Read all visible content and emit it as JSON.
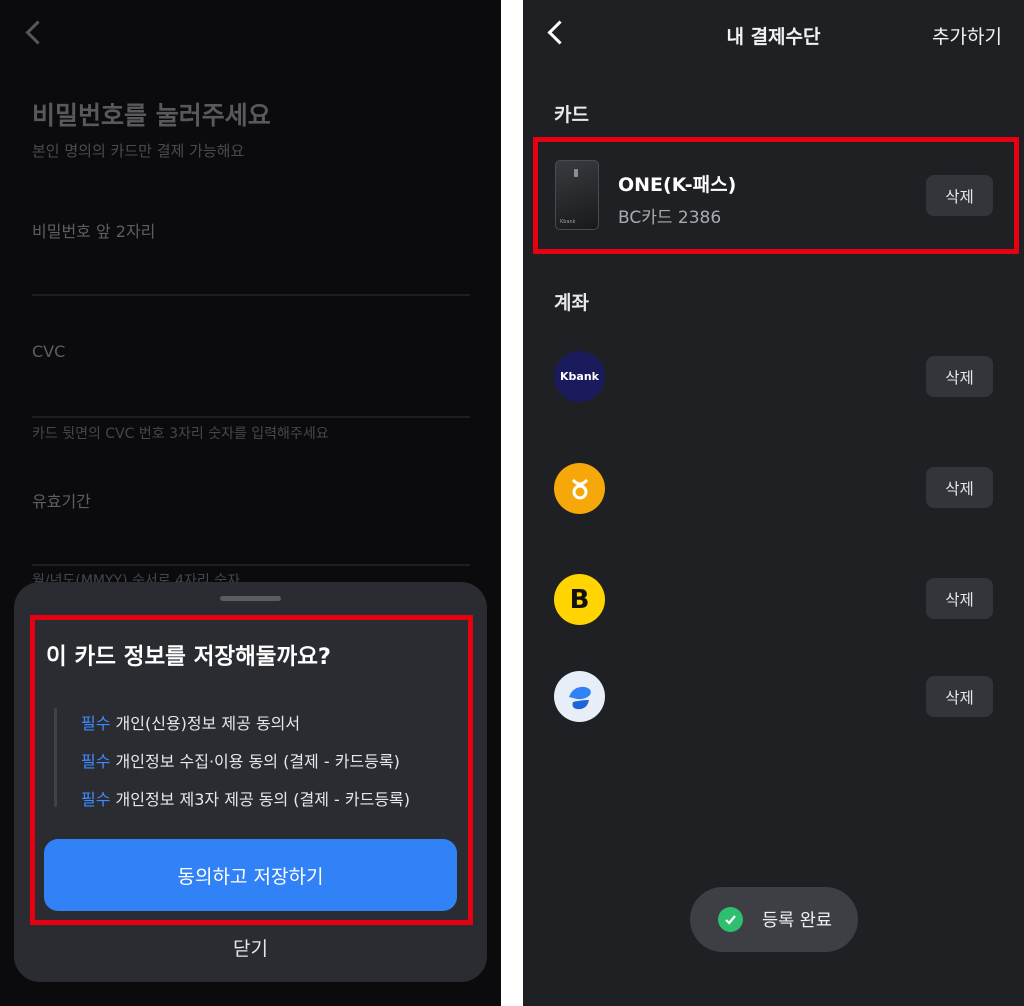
{
  "left": {
    "title": "비밀번호를 눌러주세요",
    "subtitle": "본인 명의의 카드만 결제 가능해요",
    "fields": [
      {
        "label": "비밀번호 앞 2자리"
      },
      {
        "label": "CVC",
        "hint": "카드 뒷면의 CVC 번호 3자리 숫자를 입력해주세요"
      },
      {
        "label": "유효기간",
        "hint": "월/년도(MMYY) 순서로 4자리 숫자"
      }
    ],
    "sheet": {
      "title": "이 카드 정보를 저장해둘까요?",
      "items": [
        {
          "tag": "필수",
          "text": "개인(신용)정보 제공 동의서"
        },
        {
          "tag": "필수",
          "text": "개인정보 수집·이용 동의 (결제 - 카드등록)"
        },
        {
          "tag": "필수",
          "text": "개인정보 제3자 제공 동의 (결제 - 카드등록)"
        }
      ],
      "agree_button": "동의하고 저장하기",
      "close_button": "닫기"
    }
  },
  "right": {
    "header": {
      "title": "내 결제수단",
      "add": "추가하기"
    },
    "card_section": "카드",
    "card": {
      "name": "ONE(K-패스)",
      "number": "BC카드 2386",
      "delete": "삭제",
      "brand_mark": "Kbank"
    },
    "account_section": "계좌",
    "accounts": [
      {
        "logo": "kbank-logo",
        "logo_text": "Kbank",
        "color": "#1a1b5c",
        "delete": "삭제"
      },
      {
        "logo": "bank-logo-orange",
        "logo_text": "",
        "color": "#f6a70a",
        "delete": "삭제"
      },
      {
        "logo": "bank-logo-yellow",
        "logo_text": "B",
        "color": "#ffd400",
        "delete": "삭제"
      },
      {
        "logo": "bank-logo-toss",
        "logo_text": "",
        "color": "#e8eef8",
        "delete": "삭제"
      }
    ],
    "toast": "등록 완료"
  }
}
